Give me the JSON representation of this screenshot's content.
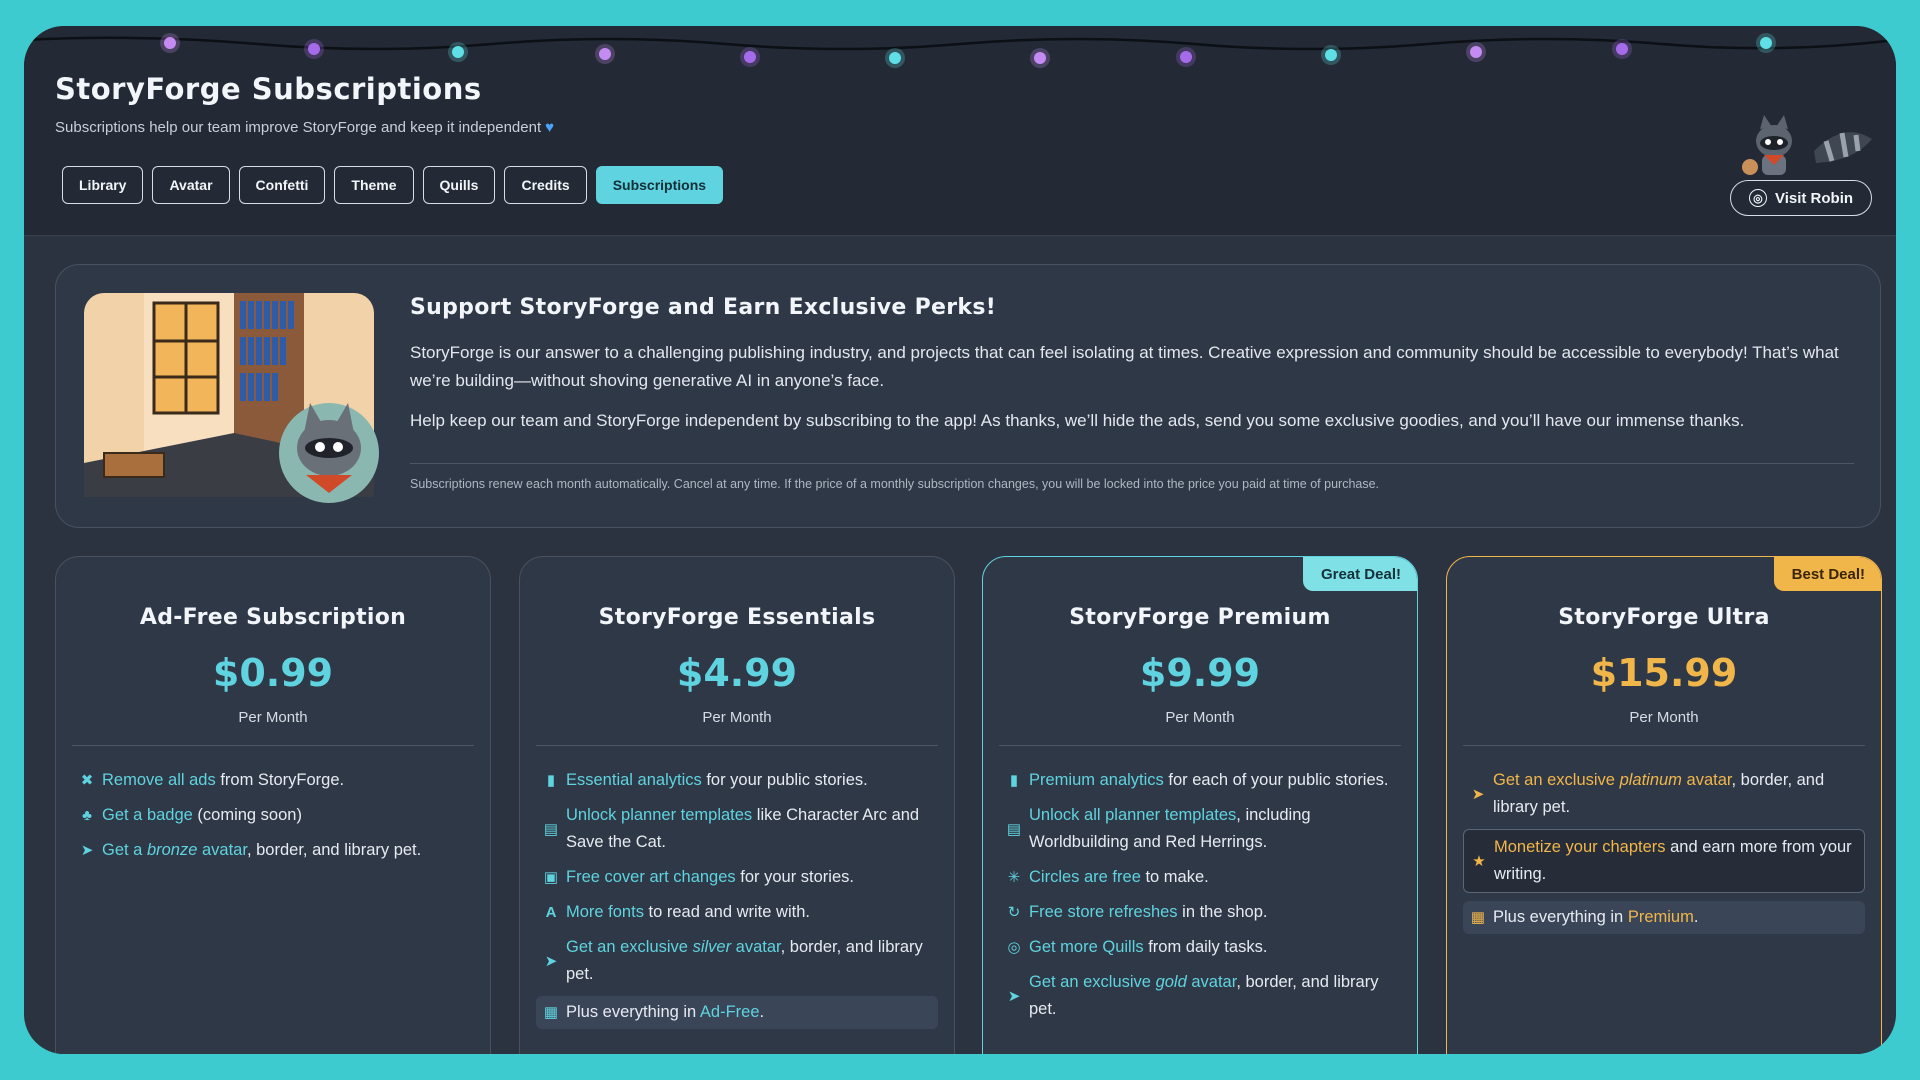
{
  "header": {
    "title": "StoryForge Subscriptions",
    "subtitle": "Subscriptions help our team improve StoryForge and keep it independent",
    "tabs": [
      "Library",
      "Avatar",
      "Confetti",
      "Theme",
      "Quills",
      "Credits",
      "Subscriptions"
    ],
    "active_tab": "Subscriptions",
    "visit_button": "Visit Robin"
  },
  "banner": {
    "heading": "Support StoryForge and Earn Exclusive Perks!",
    "paragraph1": "StoryForge is our answer to a challenging publishing industry, and projects that can feel isolating at times. Creative expression and community should be accessible to everybody! That’s what we’re building—without shoving generative AI in anyone’s face.",
    "paragraph2": "Help keep our team and StoryForge independent by subscribing to the app! As thanks, we’ll hide the ads, send you some exclusive goodies, and you’ll have our immense thanks.",
    "note": "Subscriptions renew each month automatically. Cancel at any time. If the price of a monthly subscription changes, you will be locked into the price you paid at time of purchase."
  },
  "plans": [
    {
      "title": "Ad-Free Subscription",
      "price": "$0.99",
      "per": "Per Month",
      "ribbon": "",
      "features": [
        {
          "icon": "ad-block-icon",
          "hl": "Remove all ads",
          "rest": " from StoryForge."
        },
        {
          "icon": "badge-icon",
          "hl": "Get a badge",
          "rest": " (coming soon)"
        },
        {
          "icon": "pet-icon",
          "pre": "",
          "hl": "Get a ",
          "em": "bronze",
          "hl2": " avatar",
          "rest": ", border, and library pet."
        }
      ]
    },
    {
      "title": "StoryForge Essentials",
      "price": "$4.99",
      "per": "Per Month",
      "ribbon": "",
      "features": [
        {
          "icon": "analytics-icon",
          "hl": "Essential analytics",
          "rest": " for your public stories."
        },
        {
          "icon": "planner-icon",
          "hl": "Unlock planner templates",
          "rest": " like Character Arc and Save the Cat."
        },
        {
          "icon": "image-icon",
          "hl": "Free cover art changes",
          "rest": " for your stories."
        },
        {
          "icon": "font-icon",
          "hl": "More fonts",
          "rest": " to read and write with."
        },
        {
          "icon": "pet-icon",
          "hl": "Get an exclusive ",
          "em": "silver",
          "hl2": " avatar",
          "rest": ", border, and library pet."
        },
        {
          "icon": "archive-icon",
          "pre": "Plus everything in ",
          "hl": "Ad-Free",
          "rest": ".",
          "boxed": true
        }
      ]
    },
    {
      "title": "StoryForge Premium",
      "price": "$9.99",
      "per": "Per Month",
      "ribbon": "Great Deal!",
      "features": [
        {
          "icon": "analytics-icon",
          "hl": "Premium analytics",
          "rest": " for each of your public stories."
        },
        {
          "icon": "planner-icon",
          "hl": "Unlock all planner templates",
          "rest": ", including Worldbuilding and Red Herrings."
        },
        {
          "icon": "circles-icon",
          "hl": "Circles are free",
          "rest": " to make."
        },
        {
          "icon": "refresh-icon",
          "hl": "Free store refreshes",
          "rest": " in the shop."
        },
        {
          "icon": "quill-coin-icon",
          "hl": "Get more Quills",
          "rest": " from daily tasks."
        },
        {
          "icon": "pet-icon",
          "hl": "Get an exclusive ",
          "em": "gold",
          "hl2": " avatar",
          "rest": ", border, and library pet."
        }
      ]
    },
    {
      "title": "StoryForge Ultra",
      "price": "$15.99",
      "per": "Per Month",
      "ribbon": "Best Deal!",
      "features": [
        {
          "icon": "pet-icon",
          "hl": "Get an exclusive ",
          "em": "platinum",
          "hl2": " avatar",
          "rest": ", border, and library pet."
        },
        {
          "icon": "star-icon",
          "hl": "Monetize your chapters",
          "rest": " and earn more from your writing.",
          "outlined": true
        },
        {
          "icon": "archive-icon",
          "pre": "Plus everything in ",
          "hl": "Premium",
          "rest": ".",
          "boxed": true
        }
      ]
    }
  ],
  "colors": {
    "accent": "#5fd3df",
    "gold": "#f1b64a",
    "background": "#3ecbcf",
    "panel": "#2f3846"
  }
}
